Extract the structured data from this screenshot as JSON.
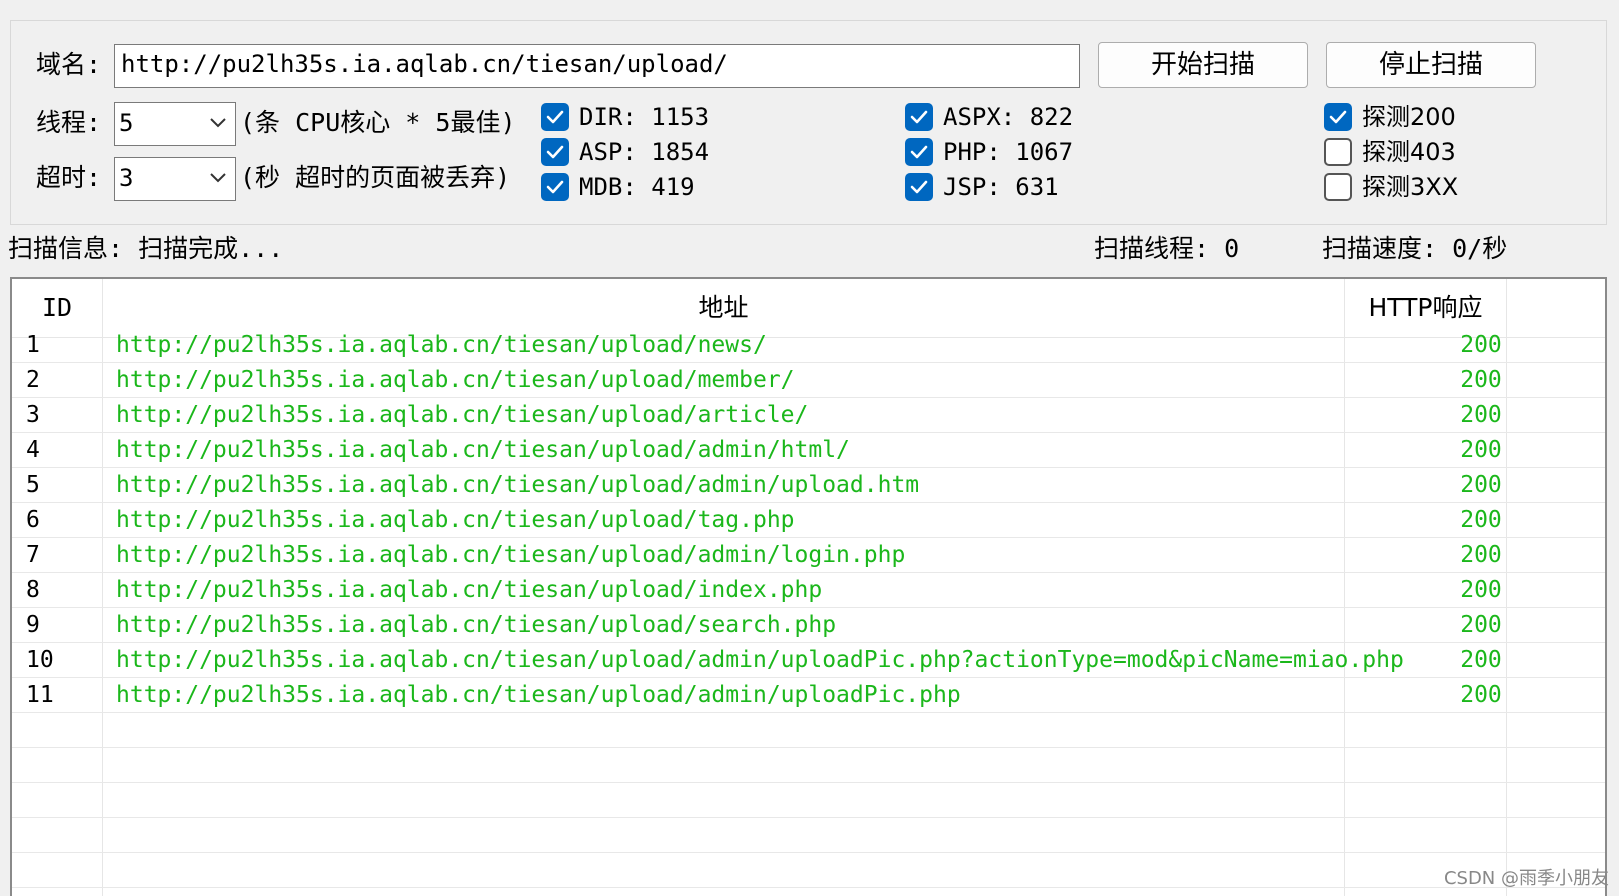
{
  "form": {
    "domain_label": "域名:",
    "domain_value": "http://pu2lh35s.ia.aqlab.cn/tiesan/upload/",
    "start_button": "开始扫描",
    "stop_button": "停止扫描",
    "threads_label": "线程:",
    "threads_value": "5",
    "threads_hint": "(条 CPU核心 * 5最佳)",
    "timeout_label": "超时:",
    "timeout_value": "3",
    "timeout_hint": "(秒 超时的页面被丢弃)"
  },
  "dicts": [
    {
      "label": "DIR: 1153",
      "checked": true
    },
    {
      "label": "ASP: 1854",
      "checked": true
    },
    {
      "label": "MDB: 419",
      "checked": true
    },
    {
      "label": "ASPX: 822",
      "checked": true
    },
    {
      "label": "PHP: 1067",
      "checked": true
    },
    {
      "label": "JSP: 631",
      "checked": true
    }
  ],
  "probes": [
    {
      "label": "探测200",
      "checked": true
    },
    {
      "label": "探测403",
      "checked": false
    },
    {
      "label": "探测3XX",
      "checked": false
    }
  ],
  "status": {
    "info": "扫描信息: 扫描完成...",
    "threads": "扫描线程: 0",
    "speed": "扫描速度: 0/秒"
  },
  "table": {
    "columns": [
      "ID",
      "地址",
      "HTTP响应"
    ],
    "rows": [
      {
        "id": "1",
        "url": "http://pu2lh35s.ia.aqlab.cn/tiesan/upload/news/",
        "code": "200"
      },
      {
        "id": "2",
        "url": "http://pu2lh35s.ia.aqlab.cn/tiesan/upload/member/",
        "code": "200"
      },
      {
        "id": "3",
        "url": "http://pu2lh35s.ia.aqlab.cn/tiesan/upload/article/",
        "code": "200"
      },
      {
        "id": "4",
        "url": "http://pu2lh35s.ia.aqlab.cn/tiesan/upload/admin/html/",
        "code": "200"
      },
      {
        "id": "5",
        "url": "http://pu2lh35s.ia.aqlab.cn/tiesan/upload/admin/upload.htm",
        "code": "200"
      },
      {
        "id": "6",
        "url": "http://pu2lh35s.ia.aqlab.cn/tiesan/upload/tag.php",
        "code": "200"
      },
      {
        "id": "7",
        "url": "http://pu2lh35s.ia.aqlab.cn/tiesan/upload/admin/login.php",
        "code": "200"
      },
      {
        "id": "8",
        "url": "http://pu2lh35s.ia.aqlab.cn/tiesan/upload/index.php",
        "code": "200"
      },
      {
        "id": "9",
        "url": "http://pu2lh35s.ia.aqlab.cn/tiesan/upload/search.php",
        "code": "200"
      },
      {
        "id": "10",
        "url": "http://pu2lh35s.ia.aqlab.cn/tiesan/upload/admin/uploadPic.php?actionType=mod&picName=miao.php",
        "code": "200"
      },
      {
        "id": "11",
        "url": "http://pu2lh35s.ia.aqlab.cn/tiesan/upload/admin/uploadPic.php",
        "code": "200"
      }
    ]
  },
  "watermark": "CSDN @雨季小朋友",
  "colors": {
    "ok_green": "#1bb71b",
    "check_blue": "#0067c0"
  }
}
